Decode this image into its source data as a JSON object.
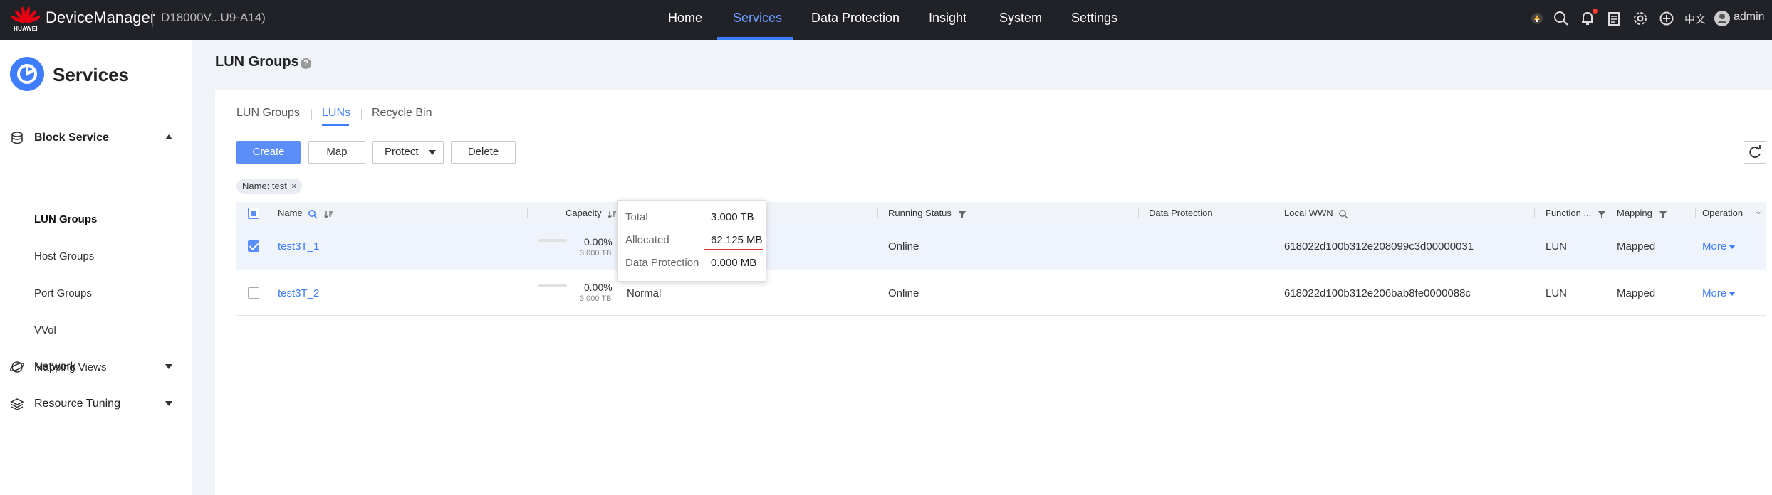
{
  "topbar": {
    "brand": "HUAWEI",
    "app_title": "DeviceManager",
    "device_name": "D18000V...U9-A14)",
    "nav": [
      "Home",
      "Services",
      "Data Protection",
      "Insight",
      "System",
      "Settings"
    ],
    "active_nav": "Services",
    "language": "中文",
    "user": "admin",
    "icons": [
      "status-icon",
      "search-icon",
      "bell-icon",
      "task-icon",
      "gear-icon",
      "plus-circle-icon",
      "user-icon"
    ]
  },
  "sidebar": {
    "title": "Services",
    "groups": [
      {
        "label": "Block Service",
        "icon": "database-icon",
        "expanded": true
      },
      {
        "label": "Network",
        "icon": "globe-icon",
        "expanded": false
      },
      {
        "label": "Resource Tuning",
        "icon": "layers-icon",
        "expanded": false
      }
    ],
    "block_items": [
      "LUN Groups",
      "Host Groups",
      "Port Groups",
      "VVol",
      "Mapping Views"
    ],
    "active_item": "LUN Groups"
  },
  "page": {
    "title": "LUN Groups",
    "help": "?"
  },
  "tabs": [
    "LUN Groups",
    "LUNs",
    "Recycle Bin"
  ],
  "active_tab": "LUNs",
  "toolbar": {
    "create": "Create",
    "map": "Map",
    "protect": "Protect",
    "delete": "Delete"
  },
  "filter": {
    "label": "Name: test",
    "close": "×"
  },
  "table": {
    "columns": {
      "name": "Name",
      "capacity": "Capacity",
      "running_status": "Running Status",
      "data_protection": "Data Protection",
      "local_wwn": "Local WWN",
      "function": "Function ...",
      "mapping": "Mapping",
      "operation": "Operation"
    },
    "scroll_glyph": "⌄",
    "rows": [
      {
        "name": "test3T_1",
        "capacity_pct": "0.00%",
        "capacity_total": "3.000 TB",
        "health": "",
        "running_status": "Online",
        "local_wwn": "618022d100b312e208099c3d00000031",
        "function": "LUN",
        "mapping": "Mapped",
        "operation": "More",
        "selected": true
      },
      {
        "name": "test3T_2",
        "capacity_pct": "0.00%",
        "capacity_total": "3.000 TB",
        "health": "Normal",
        "running_status": "Online",
        "local_wwn": "618022d100b312e206bab8fe0000088c",
        "function": "LUN",
        "mapping": "Mapped",
        "operation": "More",
        "selected": false
      }
    ]
  },
  "tooltip": {
    "total_label": "Total",
    "total_value": "3.000 TB",
    "allocated_label": "Allocated",
    "allocated_value": "62.125 MB",
    "protection_label": "Data Protection",
    "protection_value": "0.000 MB"
  },
  "colors": {
    "topbar_bg": "#202227",
    "accent": "#3f7dff",
    "primary_button": "#5b8ef7",
    "highlight_box": "#e0342f"
  }
}
